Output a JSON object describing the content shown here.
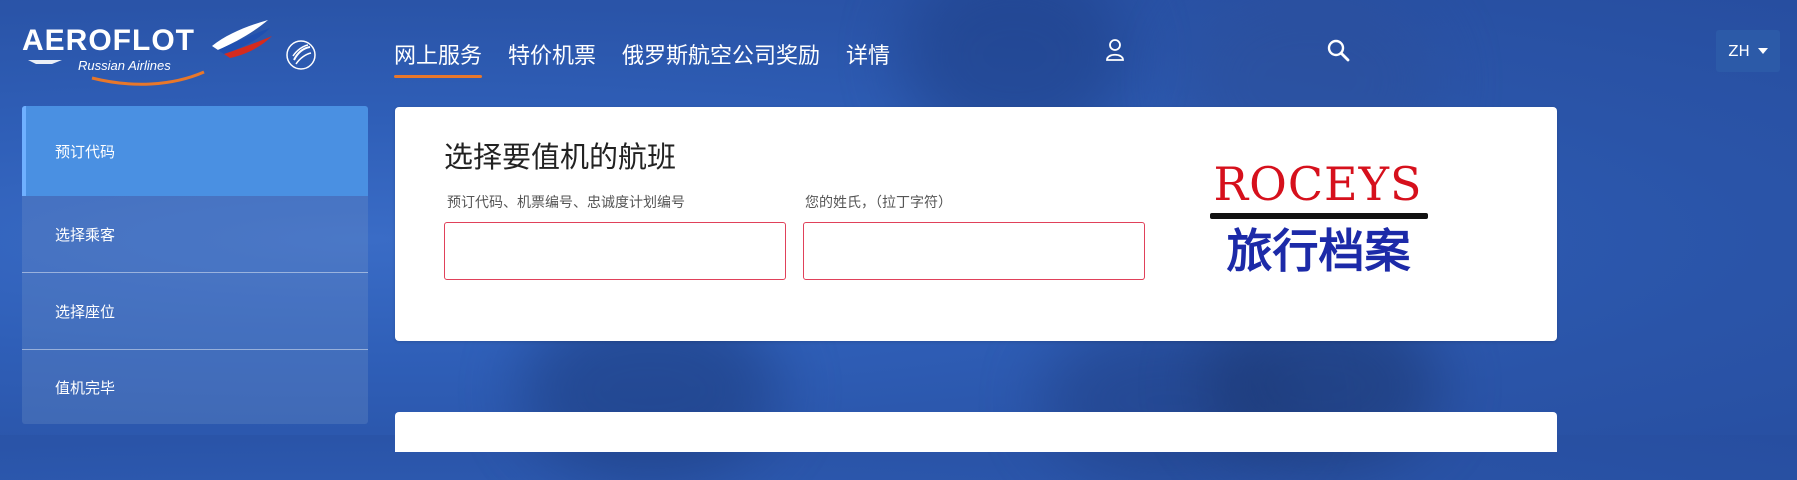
{
  "brand": {
    "name": "AEROFLOT",
    "subtitle": "Russian Airlines",
    "alliance_icon": "skyteam-logo-icon",
    "colors": {
      "wing_red": "#d52b1e",
      "wing_blue": "#1f4fb0",
      "arc_orange": "#e8772a"
    }
  },
  "nav": {
    "items": [
      {
        "label": "网上服务",
        "active": true
      },
      {
        "label": "特价机票",
        "active": false
      },
      {
        "label": "俄罗斯航空公司奖励",
        "active": false
      },
      {
        "label": "详情",
        "active": false
      }
    ],
    "user_icon": "user-icon",
    "search_icon": "search-icon",
    "language": "ZH"
  },
  "steps": [
    {
      "label": "预订代码",
      "active": true
    },
    {
      "label": "选择乘客",
      "active": false
    },
    {
      "label": "选择座位",
      "active": false
    },
    {
      "label": "值机完毕",
      "active": false
    }
  ],
  "form": {
    "title": "选择要值机的航班",
    "booking_label": "预订代码、机票编号、忠诚度计划编号",
    "booking_value": "",
    "surname_label": "您的姓氏，（拉丁字符）",
    "surname_value": ""
  },
  "watermark": {
    "top": "ROCEYS",
    "bottom": "旅行档案",
    "colors": {
      "top": "#d6101c",
      "bottom": "#1c2aa8"
    }
  },
  "theme": {
    "accent": "#e8772a",
    "active_step": "#4a90e2",
    "field_border": "#e0415a"
  }
}
